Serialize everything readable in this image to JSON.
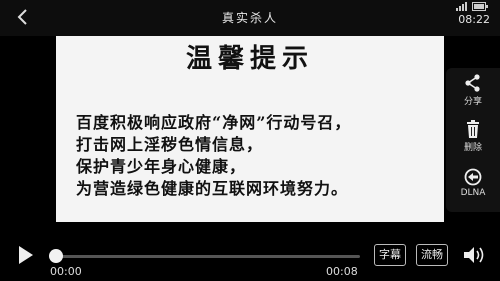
{
  "header": {
    "back_icon": "back-arrow-icon",
    "title": "真实杀人",
    "clock": "08:22",
    "status_icons": [
      "signal-icon",
      "battery-icon"
    ]
  },
  "video": {
    "heading": "温馨提示",
    "lines": [
      "百度积极响应政府“净网”行动号召，",
      "打击网上淫秽色情信息，",
      "保护青少年身心健康，",
      "为营造绿色健康的互联网环境努力。"
    ]
  },
  "side_menu": {
    "items": [
      {
        "icon": "share-icon",
        "label": "分享"
      },
      {
        "icon": "trash-icon",
        "label": "删除"
      },
      {
        "icon": "dlna-icon",
        "label": "DLNA"
      }
    ]
  },
  "controls": {
    "play_icon": "play-icon",
    "current_time": "00:00",
    "total_time": "00:08",
    "progress": 0.01,
    "subtitle_label": "字幕",
    "quality_label": "流畅",
    "volume_icon": "volume-icon"
  }
}
